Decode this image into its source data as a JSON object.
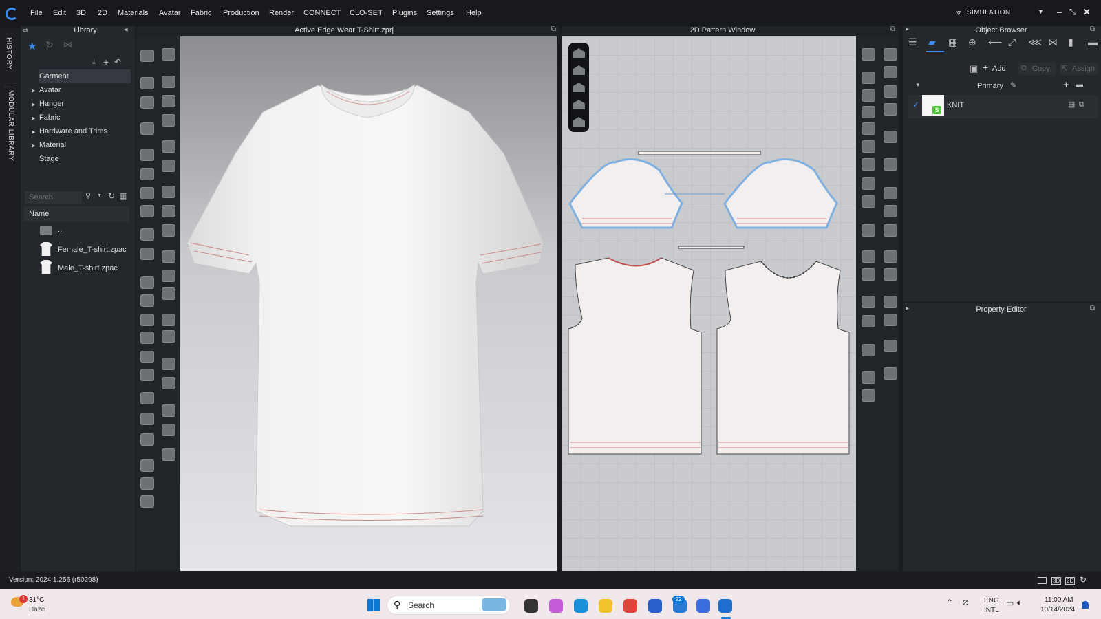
{
  "menu": [
    "File",
    "Edit",
    "3D",
    "2D",
    "Materials",
    "Avatar",
    "Fabric",
    "Production",
    "Render",
    "CONNECT",
    "CLO-SET",
    "Plugins",
    "Settings",
    "Help"
  ],
  "mode": "SIMULATION",
  "side_tabs": [
    "HISTORY",
    "MODULAR LIBRARY"
  ],
  "library": {
    "title": "Library",
    "tree": [
      "Garment",
      "Avatar",
      "Hanger",
      "Fabric",
      "Hardware and Trims",
      "Material",
      "Stage"
    ],
    "search_placeholder": "Search",
    "column_header": "Name",
    "files": [
      "..",
      "Female_T-shirt.zpac",
      "Male_T-shirt.zpac"
    ]
  },
  "viewport_title": "Active Edge Wear T-Shirt.zprj",
  "pattern_title": "2D Pattern Window",
  "object_browser": {
    "title": "Object Browser",
    "add_label": "Add",
    "copy_label": "Copy",
    "assign_label": "Assign",
    "colorway": "Primary",
    "fabric_name": "KNIT"
  },
  "property_editor_title": "Property Editor",
  "version": "Version: 2024.1.256 (r50298)",
  "taskbar": {
    "temperature": "31°C",
    "weather": "Haze",
    "weather_badge": "1",
    "search_placeholder": "Search",
    "mail_badge": "92",
    "lang_top": "ENG",
    "lang_bottom": "INTL",
    "time": "11:00 AM",
    "date": "10/14/2024"
  },
  "colors": {
    "accent": "#3a8df0",
    "panel": "#24272b",
    "pattern_bg": "#c9cbce",
    "taskbar": "#f1e8ec"
  }
}
